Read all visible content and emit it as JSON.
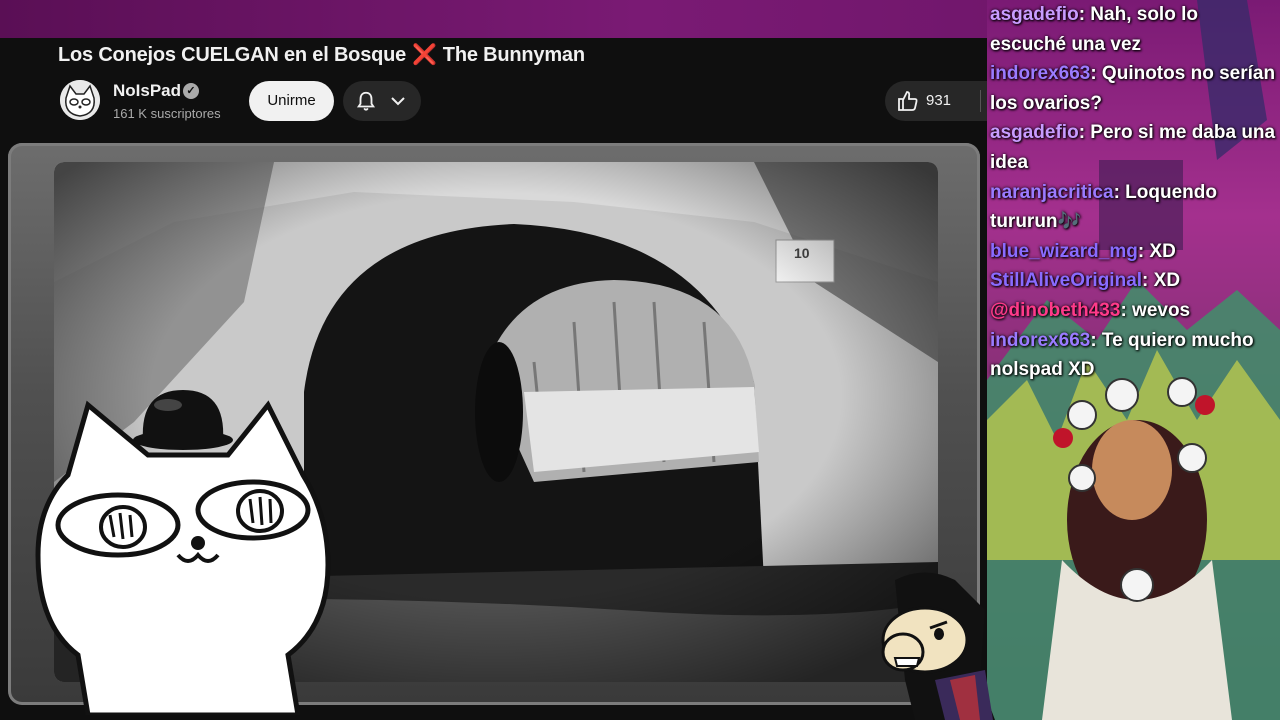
{
  "video": {
    "title_part1": "Los Conejos CUELGAN en el Bosque",
    "title_sep": "❌",
    "title_part2": "The Bunnyman"
  },
  "channel": {
    "name": "NoIsPad",
    "subscribers": "161 K suscriptores",
    "join_label": "Unirme"
  },
  "actions": {
    "like_count": "931"
  },
  "chat": [
    {
      "user": "asgadefio",
      "color": "#c89cff",
      "text": ": Nah, solo lo escuché una vez"
    },
    {
      "user": "indorex663",
      "color": "#9b7bff",
      "text": ": Quinotos no serían los ovarios?"
    },
    {
      "user": "asgadefio",
      "color": "#c89cff",
      "text": ": Pero si me daba una idea"
    },
    {
      "user": "naranjacritica",
      "color": "#9b7bff",
      "text": ": Loquendo tururun🎶"
    },
    {
      "user": "blue_wizard_mg",
      "color": "#8a6bff",
      "text": ": XD"
    },
    {
      "user": "StillAliveOriginal",
      "color": "#8a6bff",
      "text": ": XD"
    },
    {
      "user": "@dinobeth433",
      "color": "#ff3a8a",
      "text": ": wevos"
    },
    {
      "user": "indorex663",
      "color": "#9b7bff",
      "text": ": Te quiero mucho nolspad XD"
    }
  ],
  "colors": {
    "top_band": "#6a1466",
    "chat_bg": "#a4308e",
    "yt_bg": "#0f0f0f"
  }
}
